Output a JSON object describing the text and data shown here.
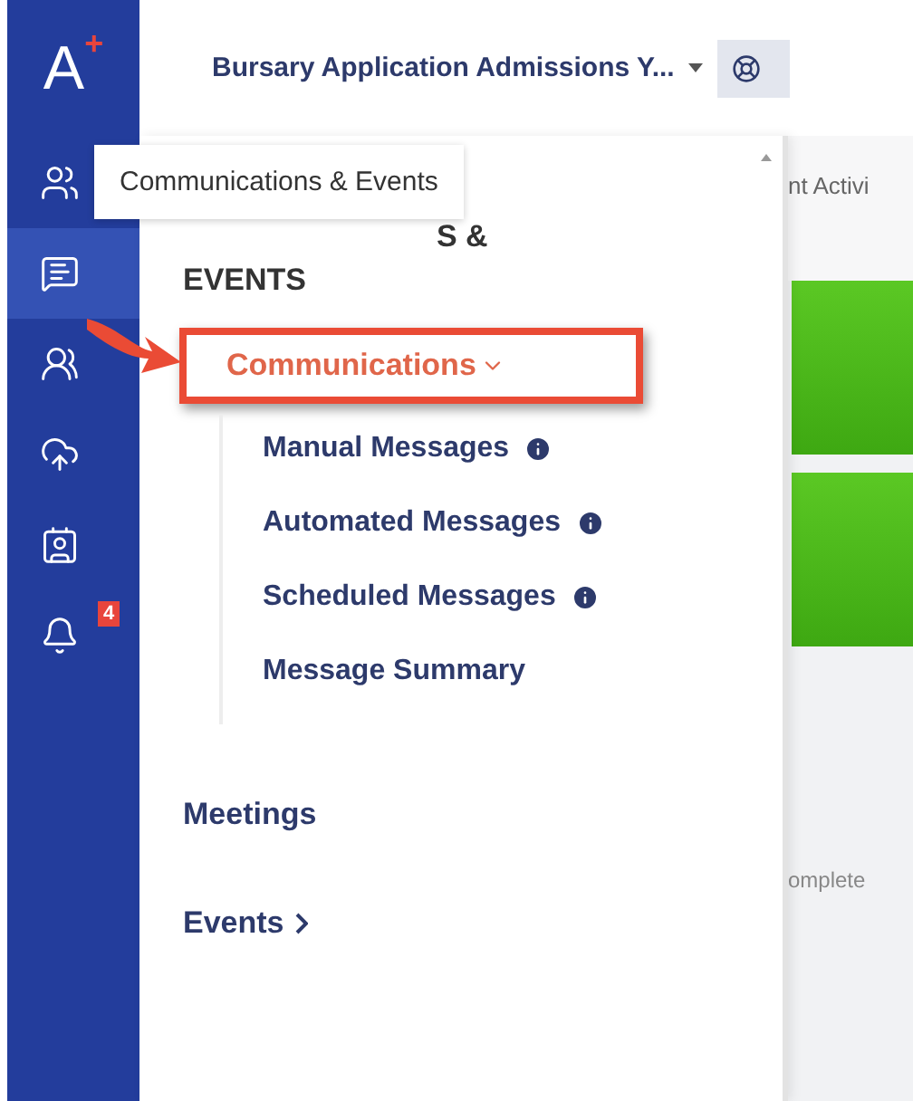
{
  "app": {
    "logo": "A",
    "logo_mark": "+"
  },
  "header": {
    "title": "Bursary Application Admissions Y..."
  },
  "rail": {
    "items": [
      {
        "kind": "people",
        "selected": false
      },
      {
        "kind": "chat",
        "selected": true
      },
      {
        "kind": "group",
        "selected": false
      },
      {
        "kind": "upload",
        "selected": false
      },
      {
        "kind": "team",
        "selected": false
      },
      {
        "kind": "bell",
        "selected": false,
        "badge": "4"
      }
    ]
  },
  "tooltip": {
    "text": "Communications & Events"
  },
  "panel": {
    "heading_lines": [
      "S &",
      "EVENTS"
    ],
    "items": [
      {
        "label": "Communications",
        "expanded": true,
        "annotated": true,
        "children": [
          {
            "label": "Manual Messages",
            "info": true
          },
          {
            "label": "Automated Messages",
            "info": true
          },
          {
            "label": "Scheduled Messages",
            "info": true
          },
          {
            "label": "Message Summary",
            "info": false
          }
        ]
      },
      {
        "label": "Meetings",
        "annotated": false
      },
      {
        "label": "Events",
        "expanded": false,
        "annotated": false
      }
    ]
  },
  "content": {
    "tab_fragment": "nt Activi",
    "status_fragment": "omplete"
  }
}
